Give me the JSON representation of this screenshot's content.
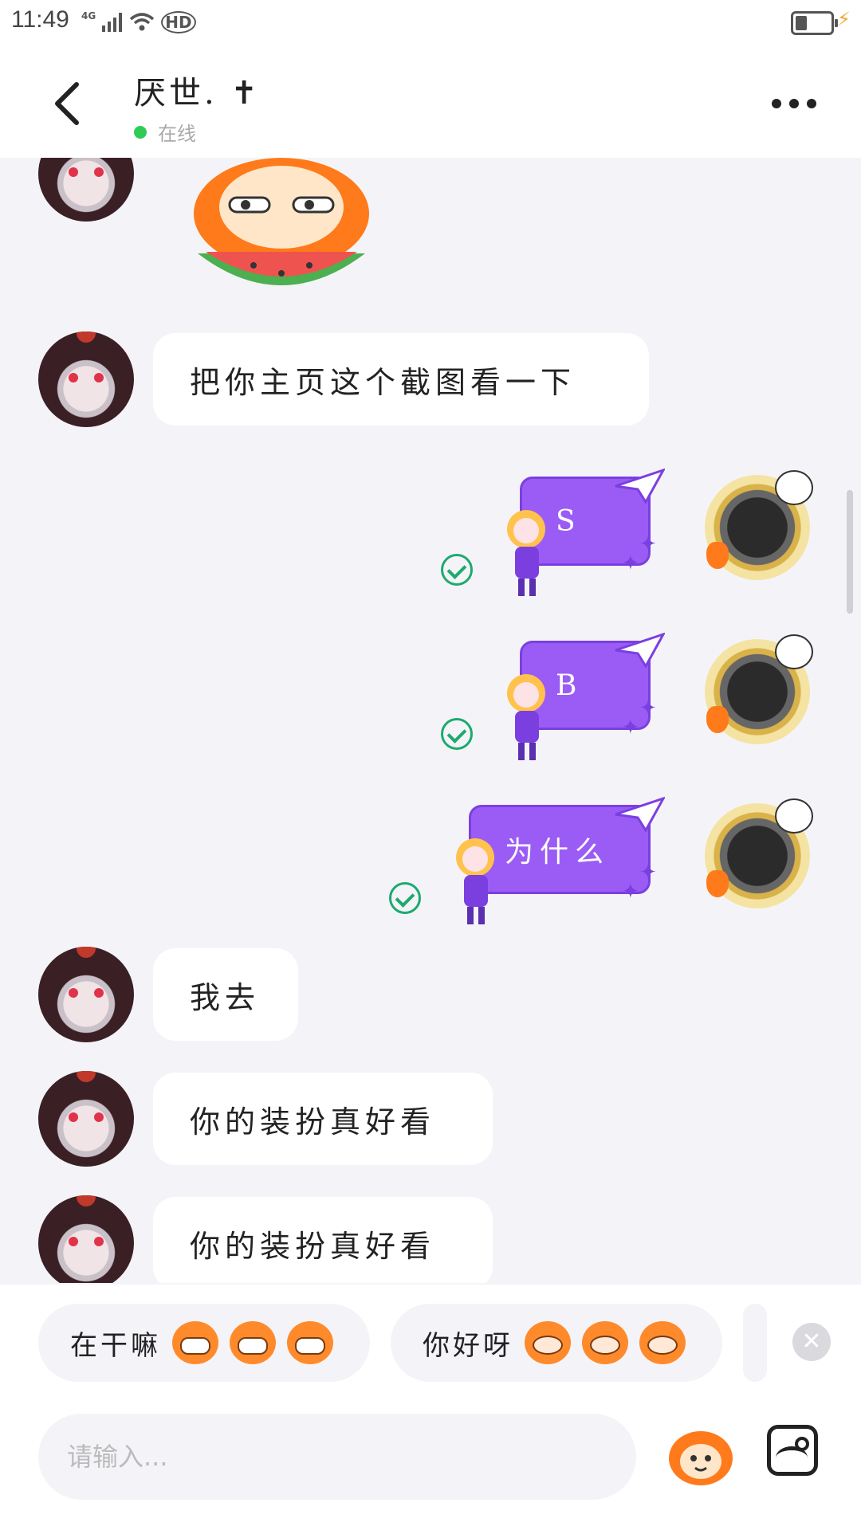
{
  "status_bar": {
    "time": "11:49",
    "network": "4G",
    "hd": "HD"
  },
  "header": {
    "title": "厌世. ✝",
    "status": "在线",
    "back_icon": "chevron-left-icon",
    "more_icon": "more-horizontal-icon"
  },
  "messages": [
    {
      "side": "left",
      "type": "sticker",
      "sticker": "orange-character-eating-watermelon"
    },
    {
      "side": "left",
      "type": "text",
      "text": "把你主页这个截图看一下"
    },
    {
      "side": "right",
      "type": "text",
      "text": "S",
      "status": "read"
    },
    {
      "side": "right",
      "type": "text",
      "text": "B",
      "status": "read"
    },
    {
      "side": "right",
      "type": "text",
      "text": "为什么",
      "status": "read"
    },
    {
      "side": "left",
      "type": "text",
      "text": "我去"
    },
    {
      "side": "left",
      "type": "text",
      "text": "你的装扮真好看"
    },
    {
      "side": "left",
      "type": "text",
      "text": "你的装扮真好看"
    }
  ],
  "quick_replies": [
    {
      "text": "在干嘛",
      "emoji": "grinning-orange-face-icon"
    },
    {
      "text": "你好呀",
      "emoji": "smiling-orange-face-icon"
    }
  ],
  "input": {
    "placeholder": "请输入..."
  },
  "colors": {
    "accent": "#9b5cf5",
    "online": "#2ecc55",
    "read_check": "#1daa6e",
    "background": "#f4f4f8"
  }
}
